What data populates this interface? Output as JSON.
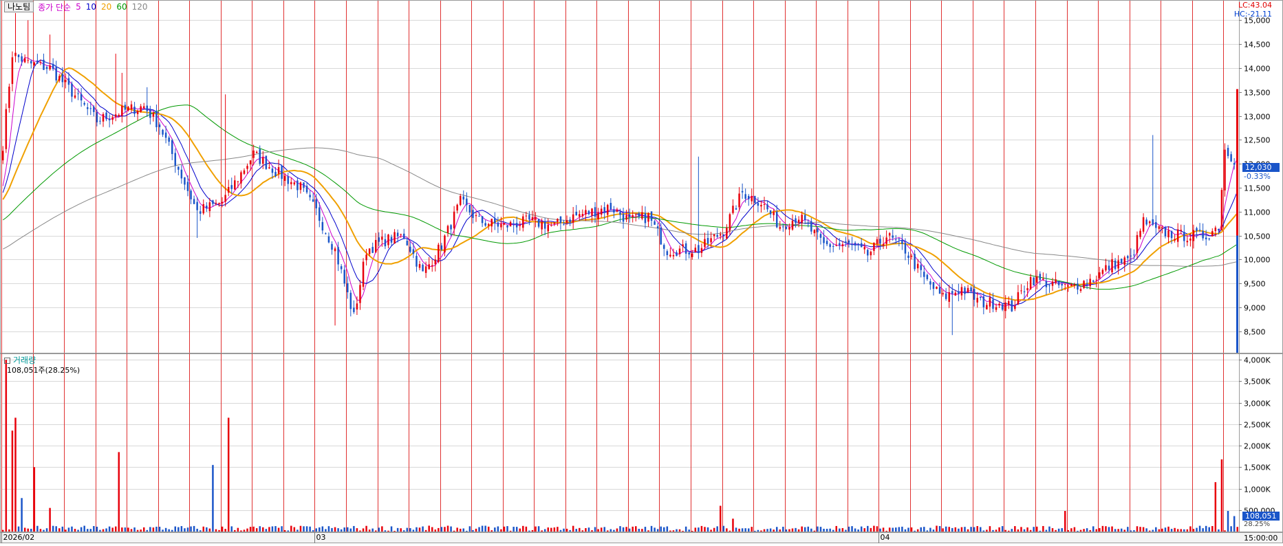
{
  "legend": {
    "stock_name": "나노팀",
    "series_label": "종가 단순",
    "ma_periods": [
      {
        "label": "5",
        "color": "#cc00cc"
      },
      {
        "label": "10",
        "color": "#0000cc"
      },
      {
        "label": "20",
        "color": "#f0a000"
      },
      {
        "label": "60",
        "color": "#009900"
      },
      {
        "label": "120",
        "color": "#888888"
      }
    ]
  },
  "volume_panel": {
    "title": "거래량",
    "current_text": "108,051주(28.25%)",
    "badge_value": "108,051",
    "badge_pct": "28.25%"
  },
  "top_right": {
    "lc": "LC:43.04",
    "hc": "HC:-21.11"
  },
  "price_badge": {
    "value": "12,030",
    "change": "-0.33%"
  },
  "time_label": "15:00:00",
  "colors": {
    "up": "#e8000b",
    "down": "#1a55c9",
    "grid": "#d8d8d8",
    "day_separator": "#e03030",
    "ma5": "#cc00cc",
    "ma10": "#0000cc",
    "ma20": "#f0a000",
    "ma60": "#009900",
    "ma120": "#888888"
  },
  "chart_data": [
    {
      "type": "candlestick",
      "title": "",
      "y_ticks": [
        "15,000",
        "14,500",
        "14,000",
        "13,500",
        "13,000",
        "12,500",
        "12,000",
        "11,500",
        "11,000",
        "10,500",
        "10,000",
        "9,500",
        "9,000",
        "8,500"
      ],
      "y_tick_values": [
        15000,
        14500,
        14000,
        13500,
        13000,
        12500,
        12000,
        11500,
        11000,
        10500,
        10000,
        9500,
        9000,
        8500
      ],
      "ylim": [
        8050,
        15250
      ],
      "x_labels": [
        {
          "label": "2026/02",
          "index": 0
        },
        {
          "label": "03",
          "index": 100
        },
        {
          "label": "04",
          "index": 280
        }
      ],
      "n_bars": 395,
      "bars_per_session": 10,
      "anchors": [
        [
          0,
          12400
        ],
        [
          3,
          14300
        ],
        [
          8,
          14100
        ],
        [
          15,
          14000
        ],
        [
          22,
          13500
        ],
        [
          30,
          12900
        ],
        [
          38,
          13100
        ],
        [
          45,
          13200
        ],
        [
          50,
          12800
        ],
        [
          56,
          11900
        ],
        [
          62,
          11000
        ],
        [
          70,
          11200
        ],
        [
          75,
          11700
        ],
        [
          80,
          12200
        ],
        [
          88,
          11800
        ],
        [
          95,
          11500
        ],
        [
          100,
          11000
        ],
        [
          106,
          10200
        ],
        [
          112,
          8800
        ],
        [
          116,
          10200
        ],
        [
          122,
          10400
        ],
        [
          128,
          10500
        ],
        [
          134,
          9700
        ],
        [
          140,
          10300
        ],
        [
          146,
          11200
        ],
        [
          152,
          10800
        ],
        [
          160,
          10700
        ],
        [
          168,
          10800
        ],
        [
          176,
          10700
        ],
        [
          182,
          10900
        ],
        [
          188,
          11000
        ],
        [
          194,
          11100
        ],
        [
          200,
          10800
        ],
        [
          206,
          10900
        ],
        [
          212,
          10200
        ],
        [
          222,
          10200
        ],
        [
          230,
          10600
        ],
        [
          236,
          11400
        ],
        [
          242,
          11200
        ],
        [
          248,
          10700
        ],
        [
          254,
          10900
        ],
        [
          262,
          10300
        ],
        [
          270,
          10300
        ],
        [
          276,
          10100
        ],
        [
          282,
          10500
        ],
        [
          288,
          10200
        ],
        [
          294,
          9600
        ],
        [
          300,
          9200
        ],
        [
          306,
          9400
        ],
        [
          312,
          9100
        ],
        [
          318,
          9100
        ],
        [
          322,
          9000
        ],
        [
          328,
          9600
        ],
        [
          334,
          9500
        ],
        [
          340,
          9400
        ],
        [
          348,
          9600
        ],
        [
          354,
          9900
        ],
        [
          360,
          10000
        ],
        [
          364,
          10800
        ],
        [
          368,
          10600
        ],
        [
          376,
          10500
        ],
        [
          384,
          10500
        ],
        [
          388,
          10700
        ],
        [
          390,
          12300
        ],
        [
          394,
          12030
        ]
      ],
      "ma_periods": [
        5,
        10,
        20,
        60,
        120
      ],
      "last_close": 12030,
      "change_pct": -0.33
    },
    {
      "type": "bar",
      "title": "거래량",
      "y_ticks": [
        "4,000K",
        "3,500K",
        "3,000K",
        "2,500K",
        "2,000K",
        "1,500K",
        "1,000K",
        "500,000"
      ],
      "y_tick_values": [
        4000000,
        3500000,
        3000000,
        2500000,
        2000000,
        1500000,
        1000000,
        500000
      ],
      "ylim": [
        0,
        4050000
      ],
      "spikes": [
        [
          1,
          4000000
        ],
        [
          3,
          2350000
        ],
        [
          4,
          2650000
        ],
        [
          6,
          780000
        ],
        [
          10,
          1500000
        ],
        [
          15,
          550000
        ],
        [
          37,
          1850000
        ],
        [
          67,
          1550000
        ],
        [
          72,
          2650000
        ],
        [
          229,
          600000
        ],
        [
          233,
          300000
        ],
        [
          339,
          480000
        ],
        [
          387,
          1150000
        ],
        [
          389,
          1680000
        ],
        [
          391,
          480000
        ],
        [
          393,
          360000
        ]
      ],
      "baseline_volume": 110000,
      "last_volume": 108051
    }
  ]
}
